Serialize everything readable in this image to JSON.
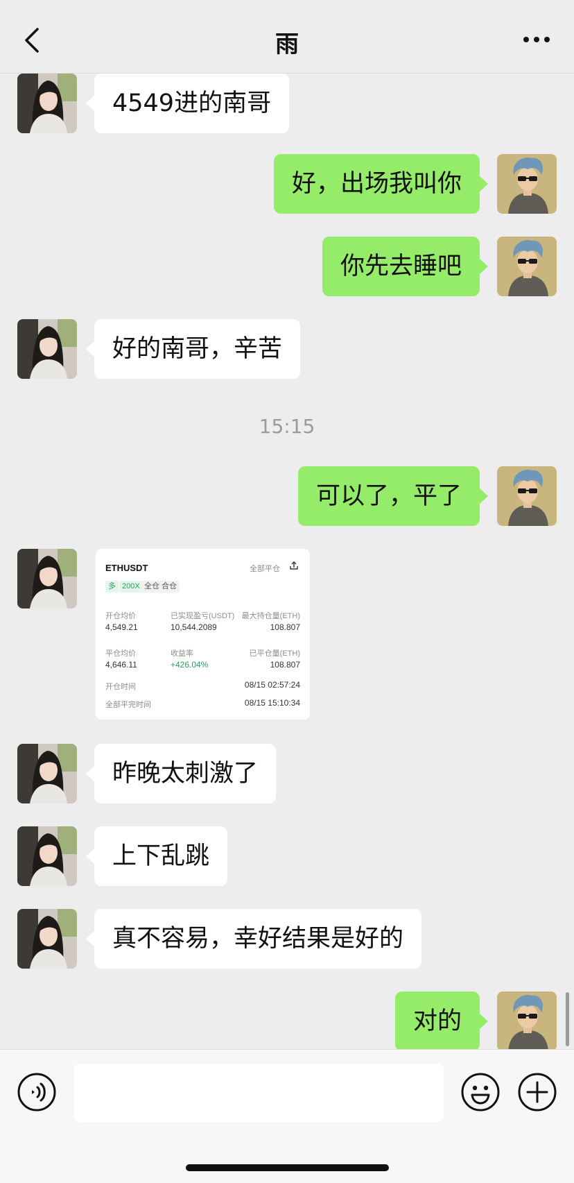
{
  "header": {
    "title": "雨"
  },
  "messages": [
    {
      "side": "left",
      "text": "4549进的南哥"
    },
    {
      "side": "right",
      "text": "好，出场我叫你"
    },
    {
      "side": "right",
      "text": "你先去睡吧"
    },
    {
      "side": "left",
      "text": "好的南哥，辛苦"
    },
    {
      "timestamp": "15:15"
    },
    {
      "side": "right",
      "text": "可以了，平了"
    },
    {
      "side": "left",
      "type": "image-card"
    },
    {
      "side": "left",
      "text": "昨晚太刺激了"
    },
    {
      "side": "left",
      "text": "上下乱跳"
    },
    {
      "side": "left",
      "text": "真不容易，幸好结果是好的"
    },
    {
      "side": "right",
      "text": "对的"
    }
  ],
  "card": {
    "symbol": "ETHUSDT",
    "close_all": "全部平仓",
    "tag_direction": "多",
    "tag_leverage": "200X",
    "tag_mode": "全仓 合仓",
    "open_avg_label": "开仓均价",
    "open_avg_value": "4,549.21",
    "realized_pnl_label": "已实现盈亏(USDT)",
    "realized_pnl_value": "10,544.2089",
    "max_position_label": "最大持仓量(ETH)",
    "max_position_value": "108.807",
    "close_avg_label": "平仓均价",
    "close_avg_value": "4,646.11",
    "roi_label": "收益率",
    "roi_value": "+426.04%",
    "closed_qty_label": "已平仓量(ETH)",
    "closed_qty_value": "108.807",
    "open_time_label": "开仓时间",
    "open_time_value": "08/15 02:57:24",
    "close_time_label": "全部平完时间",
    "close_time_value": "08/15 15:10:34"
  },
  "colors": {
    "background": "#ededed",
    "bubble_self": "#95ec69",
    "bubble_other": "#ffffff",
    "roi_green": "#1fa65c"
  },
  "icons": {
    "back": "chevron-left-icon",
    "more": "more-dots-icon",
    "voice": "voice-icon",
    "emoji": "emoji-icon",
    "plus": "plus-icon",
    "share": "share-icon"
  }
}
